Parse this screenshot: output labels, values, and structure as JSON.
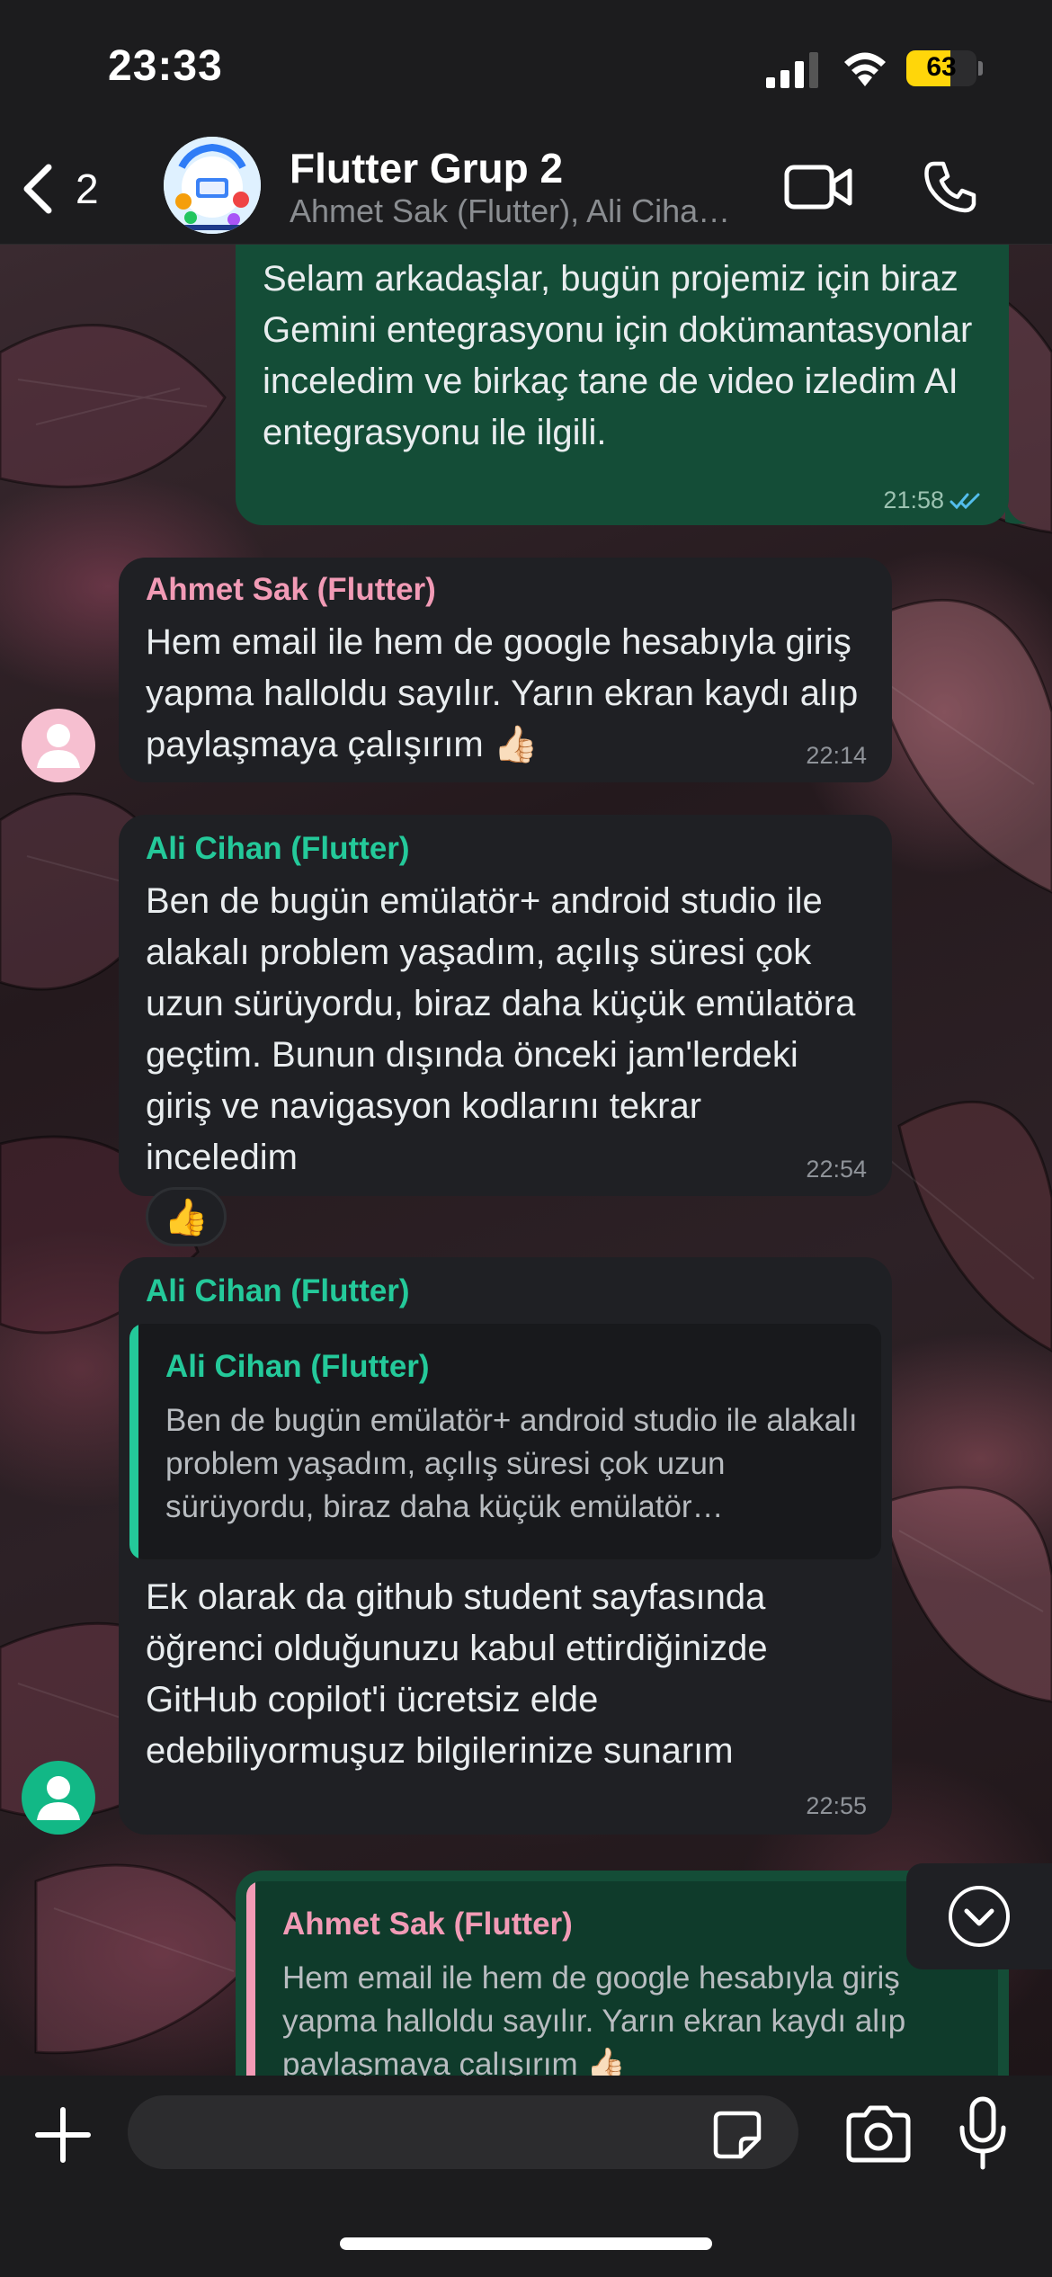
{
  "status_bar": {
    "time": "23:33",
    "battery_percent": "63",
    "battery_level": 0.63,
    "battery_color": "#ffd60a"
  },
  "header": {
    "back_count": "2",
    "title": "Flutter Grup 2",
    "subtitle": "Ahmet Sak (Flutter), Ali Cihan (Flutter)",
    "icons": [
      "chevron-left-icon",
      "video-call-icon",
      "phone-icon"
    ]
  },
  "colors": {
    "outgoing_bubble": "#144d37",
    "incoming_bubble": "#1f2024",
    "ahmet_name": "#f29bb6",
    "ali_name": "#24c99a",
    "read_tick": "#53bdeb"
  },
  "messages": [
    {
      "direction": "outgoing",
      "text": "Selam arkadaşlar, bugün projemiz için biraz Gemini entegrasyonu için dokümantasyonlar inceledim ve birkaç tane de video izledim AI entegrasyonu ile ilgili.",
      "time": "21:58",
      "status": "read"
    },
    {
      "direction": "incoming",
      "sender": "Ahmet Sak (Flutter)",
      "text": "Hem email ile hem de google hesabıyla giriş yapma halloldu sayılır. Yarın ekran kaydı alıp paylaşmaya çalışırım 👍🏻",
      "time": "22:14"
    },
    {
      "direction": "incoming",
      "sender": "Ali Cihan (Flutter)",
      "text": "Ben de bugün emülatör+ android studio ile alakalı problem yaşadım, açılış süresi çok uzun sürüyordu, biraz daha küçük emülatöra geçtim. Bunun dışında önceki jam'lerdeki giriş ve navigasyon kodlarını tekrar inceledim",
      "time": "22:54",
      "reaction": "👍"
    },
    {
      "direction": "incoming",
      "sender": "Ali Cihan (Flutter)",
      "quote_sender": "Ali Cihan (Flutter)",
      "quote_text": "Ben de bugün emülatör+ android studio ile alakalı problem yaşadım, açılış süresi çok uzun sürüyordu, biraz daha küçük emülatör…",
      "text": "Ek olarak da github student sayfasında öğrenci olduğunuzu kabul ettirdiğinizde GitHub copilot'i ücretsiz elde edebiliyormuşuz bilgilerinize sunarım",
      "time": "22:55"
    },
    {
      "direction": "outgoing",
      "quote_sender": "Ahmet Sak (Flutter)",
      "quote_text": "Hem email ile hem de google hesabıyla giriş yapma halloldu sayılır. Yarın ekran kaydı alıp paylaşmaya çalışırım 👍🏻"
    }
  ],
  "composer": {
    "value": "",
    "icons": [
      "plus-icon",
      "sticker-icon",
      "camera-icon",
      "microphone-icon"
    ]
  }
}
